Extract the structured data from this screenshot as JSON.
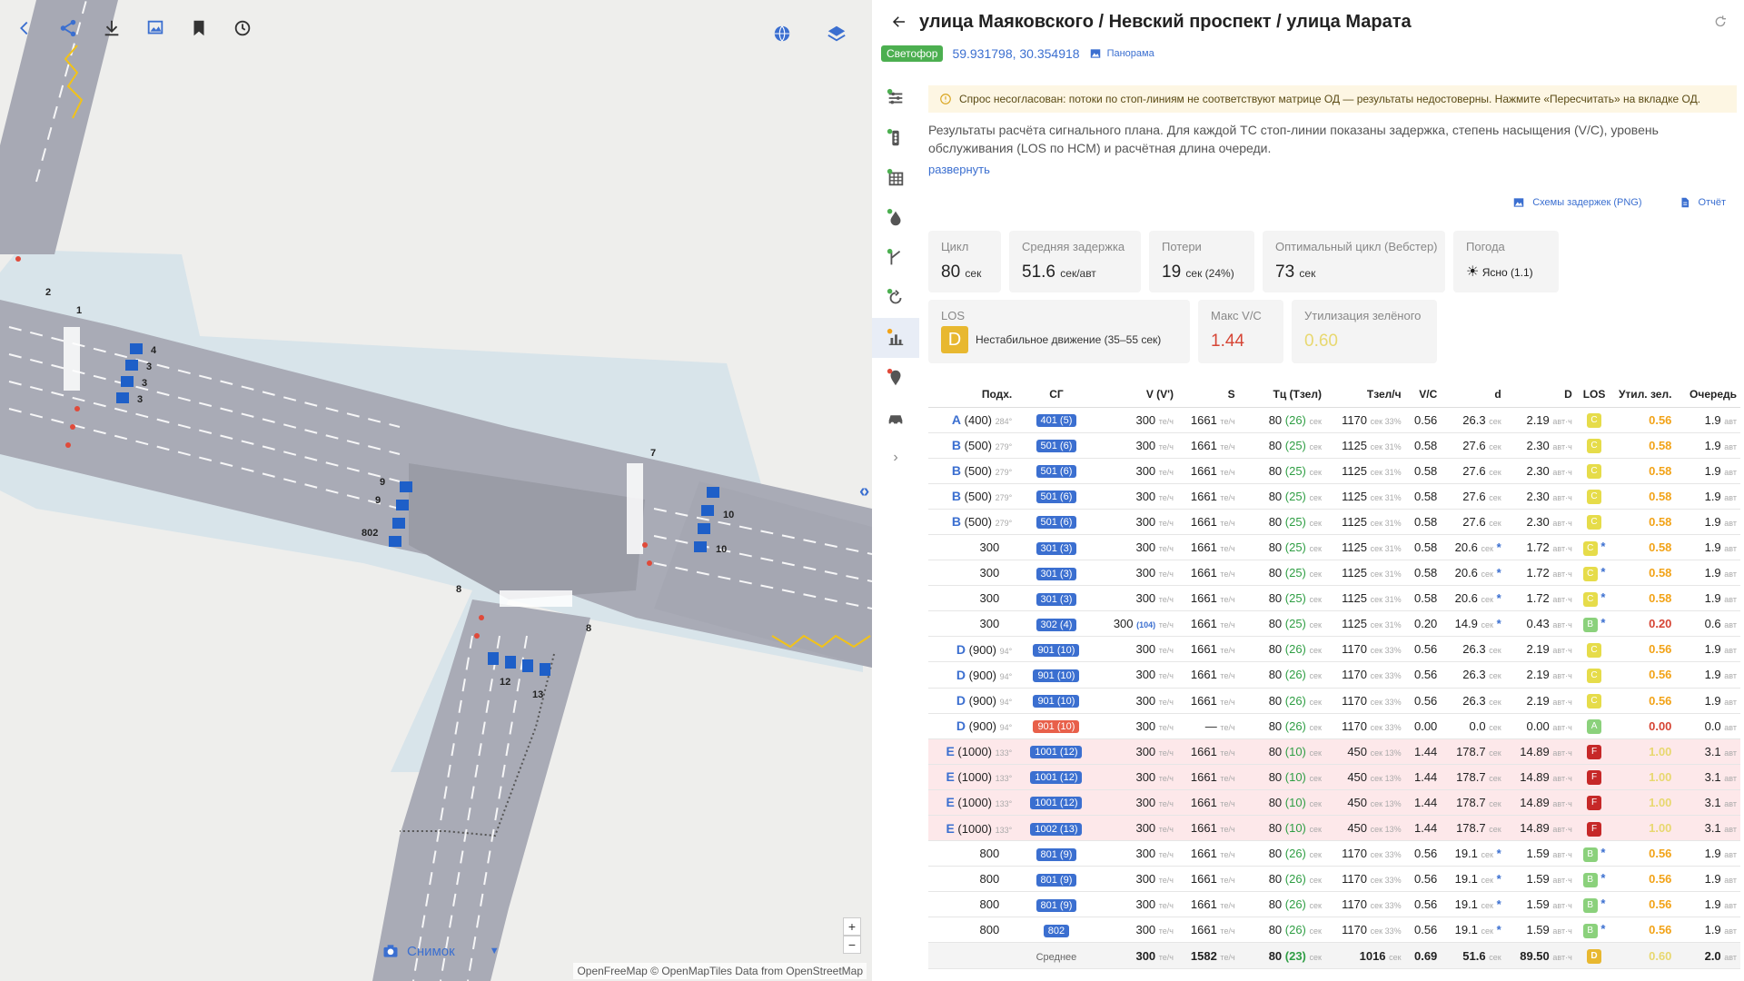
{
  "map": {
    "lane_numbers": [
      "4",
      "3",
      "3",
      "3",
      "9",
      "9",
      "802",
      "10",
      "10",
      "12",
      "13",
      "2",
      "1",
      "7",
      "8",
      "8"
    ],
    "snapshot_label": "Снимок",
    "attribution": "OpenFreeMap © OpenMapTiles Data from OpenStreetMap",
    "zoom_in": "+",
    "zoom_out": "−"
  },
  "header": {
    "title": "улица Маяковского / Невский проспект / улица Марата",
    "type_badge": "Светофор",
    "coords": "59.931798, 30.354918",
    "panorama": "Панорама"
  },
  "warning": "Спрос несогласован: потоки по стоп-линиям не соответствуют матрице ОД — результаты недостоверны. Нажмите «Пересчитать» на вкладке ОД.",
  "description": "Результаты расчёта сигнального плана. Для каждой ТС стоп-линии показаны задержка, степень насыщения (V/C), уровень обслуживания (LOS по HCM) и расчётная длина очереди.",
  "expand": "развернуть",
  "exports": {
    "png": "Схемы задержек (PNG)",
    "report": "Отчёт"
  },
  "stats": {
    "cycle": {
      "label": "Цикл",
      "value": "80",
      "unit": "сек"
    },
    "delay": {
      "label": "Средняя задержка",
      "value": "51.6",
      "unit": "сек/авт"
    },
    "losses": {
      "label": "Потери",
      "value": "19",
      "unit": "сек (24%)"
    },
    "opt_cycle": {
      "label": "Оптимальный цикл (Вебстер)",
      "value": "73",
      "unit": "сек"
    },
    "weather": {
      "label": "Погода",
      "value": "Ясно (1.1)"
    },
    "los": {
      "label": "LOS",
      "letter": "D",
      "text": "Нестабильное движение (35–55 сек)"
    },
    "max_vc": {
      "label": "Макс V/C",
      "value": "1.44",
      "color": "#d64535"
    },
    "green_util": {
      "label": "Утилизация зелёного",
      "value": "0.60",
      "color": "#e8d870"
    }
  },
  "table": {
    "headers": [
      "Подх.",
      "СГ",
      "V (V')",
      "S",
      "Тц (Тзел)",
      "Тзел/ч",
      "V/C",
      "d",
      "D",
      "LOS",
      "Утил. зел.",
      "Очередь"
    ],
    "units": {
      "veh_h": "те/ч",
      "sec": "сек",
      "veh_hour": "авт·ч",
      "veh": "авт"
    },
    "rows": [
      {
        "letter": "A",
        "app": "(400)",
        "deg": "284°",
        "sg": "401 (5)",
        "sg_red": false,
        "v": "300",
        "vp": "",
        "s": "1661",
        "tc": "80",
        "tg": "(26)",
        "tgh": "1170",
        "pct": "33%",
        "vc": "0.56",
        "d": "26.3",
        "dstar": false,
        "D": "2.19",
        "los": "C",
        "los_star": false,
        "util": "0.56",
        "q": "1.9",
        "red": false
      },
      {
        "letter": "B",
        "app": "(500)",
        "deg": "279°",
        "sg": "501 (6)",
        "sg_red": false,
        "v": "300",
        "vp": "",
        "s": "1661",
        "tc": "80",
        "tg": "(25)",
        "tgh": "1125",
        "pct": "31%",
        "vc": "0.58",
        "d": "27.6",
        "dstar": false,
        "D": "2.30",
        "los": "C",
        "los_star": false,
        "util": "0.58",
        "q": "1.9",
        "red": false
      },
      {
        "letter": "B",
        "app": "(500)",
        "deg": "279°",
        "sg": "501 (6)",
        "sg_red": false,
        "v": "300",
        "vp": "",
        "s": "1661",
        "tc": "80",
        "tg": "(25)",
        "tgh": "1125",
        "pct": "31%",
        "vc": "0.58",
        "d": "27.6",
        "dstar": false,
        "D": "2.30",
        "los": "C",
        "los_star": false,
        "util": "0.58",
        "q": "1.9",
        "red": false
      },
      {
        "letter": "B",
        "app": "(500)",
        "deg": "279°",
        "sg": "501 (6)",
        "sg_red": false,
        "v": "300",
        "vp": "",
        "s": "1661",
        "tc": "80",
        "tg": "(25)",
        "tgh": "1125",
        "pct": "31%",
        "vc": "0.58",
        "d": "27.6",
        "dstar": false,
        "D": "2.30",
        "los": "C",
        "los_star": false,
        "util": "0.58",
        "q": "1.9",
        "red": false
      },
      {
        "letter": "B",
        "app": "(500)",
        "deg": "279°",
        "sg": "501 (6)",
        "sg_red": false,
        "v": "300",
        "vp": "",
        "s": "1661",
        "tc": "80",
        "tg": "(25)",
        "tgh": "1125",
        "pct": "31%",
        "vc": "0.58",
        "d": "27.6",
        "dstar": false,
        "D": "2.30",
        "los": "C",
        "los_star": false,
        "util": "0.58",
        "q": "1.9",
        "red": false
      },
      {
        "letter": "",
        "app": "300",
        "deg": "",
        "sg": "301 (3)",
        "sg_red": false,
        "v": "300",
        "vp": "",
        "s": "1661",
        "tc": "80",
        "tg": "(25)",
        "tgh": "1125",
        "pct": "31%",
        "vc": "0.58",
        "d": "20.6",
        "dstar": true,
        "D": "1.72",
        "los": "C",
        "los_star": true,
        "util": "0.58",
        "q": "1.9",
        "red": false
      },
      {
        "letter": "",
        "app": "300",
        "deg": "",
        "sg": "301 (3)",
        "sg_red": false,
        "v": "300",
        "vp": "",
        "s": "1661",
        "tc": "80",
        "tg": "(25)",
        "tgh": "1125",
        "pct": "31%",
        "vc": "0.58",
        "d": "20.6",
        "dstar": true,
        "D": "1.72",
        "los": "C",
        "los_star": true,
        "util": "0.58",
        "q": "1.9",
        "red": false
      },
      {
        "letter": "",
        "app": "300",
        "deg": "",
        "sg": "301 (3)",
        "sg_red": false,
        "v": "300",
        "vp": "",
        "s": "1661",
        "tc": "80",
        "tg": "(25)",
        "tgh": "1125",
        "pct": "31%",
        "vc": "0.58",
        "d": "20.6",
        "dstar": true,
        "D": "1.72",
        "los": "C",
        "los_star": true,
        "util": "0.58",
        "q": "1.9",
        "red": false
      },
      {
        "letter": "",
        "app": "300",
        "deg": "",
        "sg": "302 (4)",
        "sg_red": false,
        "v": "300",
        "vp": "(104)",
        "s": "1661",
        "tc": "80",
        "tg": "(25)",
        "tgh": "1125",
        "pct": "31%",
        "vc": "0.20",
        "d": "14.9",
        "dstar": true,
        "D": "0.43",
        "los": "B",
        "los_star": true,
        "util": "0.20",
        "q": "0.6",
        "red": false
      },
      {
        "letter": "D",
        "app": "(900)",
        "deg": "94°",
        "sg": "901 (10)",
        "sg_red": false,
        "v": "300",
        "vp": "",
        "s": "1661",
        "tc": "80",
        "tg": "(26)",
        "tgh": "1170",
        "pct": "33%",
        "vc": "0.56",
        "d": "26.3",
        "dstar": false,
        "D": "2.19",
        "los": "C",
        "los_star": false,
        "util": "0.56",
        "q": "1.9",
        "red": false
      },
      {
        "letter": "D",
        "app": "(900)",
        "deg": "94°",
        "sg": "901 (10)",
        "sg_red": false,
        "v": "300",
        "vp": "",
        "s": "1661",
        "tc": "80",
        "tg": "(26)",
        "tgh": "1170",
        "pct": "33%",
        "vc": "0.56",
        "d": "26.3",
        "dstar": false,
        "D": "2.19",
        "los": "C",
        "los_star": false,
        "util": "0.56",
        "q": "1.9",
        "red": false
      },
      {
        "letter": "D",
        "app": "(900)",
        "deg": "94°",
        "sg": "901 (10)",
        "sg_red": false,
        "v": "300",
        "vp": "",
        "s": "1661",
        "tc": "80",
        "tg": "(26)",
        "tgh": "1170",
        "pct": "33%",
        "vc": "0.56",
        "d": "26.3",
        "dstar": false,
        "D": "2.19",
        "los": "C",
        "los_star": false,
        "util": "0.56",
        "q": "1.9",
        "red": false
      },
      {
        "letter": "D",
        "app": "(900)",
        "deg": "94°",
        "sg": "901 (10)",
        "sg_red": true,
        "v": "300",
        "vp": "",
        "s": "—",
        "tc": "80",
        "tg": "(26)",
        "tgh": "1170",
        "pct": "33%",
        "vc": "0.00",
        "d": "0.0",
        "dstar": false,
        "D": "0.00",
        "los": "A",
        "los_star": false,
        "util": "0.00",
        "q": "0.0",
        "red": false
      },
      {
        "letter": "E",
        "app": "(1000)",
        "deg": "133°",
        "sg": "1001 (12)",
        "sg_red": false,
        "v": "300",
        "vp": "",
        "s": "1661",
        "tc": "80",
        "tg": "(10)",
        "tgh": "450",
        "pct": "13%",
        "vc": "1.44",
        "d": "178.7",
        "dstar": false,
        "D": "14.89",
        "los": "F",
        "los_star": false,
        "util": "1.00",
        "q": "3.1",
        "red": true
      },
      {
        "letter": "E",
        "app": "(1000)",
        "deg": "133°",
        "sg": "1001 (12)",
        "sg_red": false,
        "v": "300",
        "vp": "",
        "s": "1661",
        "tc": "80",
        "tg": "(10)",
        "tgh": "450",
        "pct": "13%",
        "vc": "1.44",
        "d": "178.7",
        "dstar": false,
        "D": "14.89",
        "los": "F",
        "los_star": false,
        "util": "1.00",
        "q": "3.1",
        "red": true
      },
      {
        "letter": "E",
        "app": "(1000)",
        "deg": "133°",
        "sg": "1001 (12)",
        "sg_red": false,
        "v": "300",
        "vp": "",
        "s": "1661",
        "tc": "80",
        "tg": "(10)",
        "tgh": "450",
        "pct": "13%",
        "vc": "1.44",
        "d": "178.7",
        "dstar": false,
        "D": "14.89",
        "los": "F",
        "los_star": false,
        "util": "1.00",
        "q": "3.1",
        "red": true
      },
      {
        "letter": "E",
        "app": "(1000)",
        "deg": "133°",
        "sg": "1002 (13)",
        "sg_red": false,
        "v": "300",
        "vp": "",
        "s": "1661",
        "tc": "80",
        "tg": "(10)",
        "tgh": "450",
        "pct": "13%",
        "vc": "1.44",
        "d": "178.7",
        "dstar": false,
        "D": "14.89",
        "los": "F",
        "los_star": false,
        "util": "1.00",
        "q": "3.1",
        "red": true
      },
      {
        "letter": "",
        "app": "800",
        "deg": "",
        "sg": "801 (9)",
        "sg_red": false,
        "v": "300",
        "vp": "",
        "s": "1661",
        "tc": "80",
        "tg": "(26)",
        "tgh": "1170",
        "pct": "33%",
        "vc": "0.56",
        "d": "19.1",
        "dstar": true,
        "D": "1.59",
        "los": "B",
        "los_star": true,
        "util": "0.56",
        "q": "1.9",
        "red": false
      },
      {
        "letter": "",
        "app": "800",
        "deg": "",
        "sg": "801 (9)",
        "sg_red": false,
        "v": "300",
        "vp": "",
        "s": "1661",
        "tc": "80",
        "tg": "(26)",
        "tgh": "1170",
        "pct": "33%",
        "vc": "0.56",
        "d": "19.1",
        "dstar": true,
        "D": "1.59",
        "los": "B",
        "los_star": true,
        "util": "0.56",
        "q": "1.9",
        "red": false
      },
      {
        "letter": "",
        "app": "800",
        "deg": "",
        "sg": "801 (9)",
        "sg_red": false,
        "v": "300",
        "vp": "",
        "s": "1661",
        "tc": "80",
        "tg": "(26)",
        "tgh": "1170",
        "pct": "33%",
        "vc": "0.56",
        "d": "19.1",
        "dstar": true,
        "D": "1.59",
        "los": "B",
        "los_star": true,
        "util": "0.56",
        "q": "1.9",
        "red": false
      },
      {
        "letter": "",
        "app": "800",
        "deg": "",
        "sg": "802",
        "sg_red": false,
        "v": "300",
        "vp": "",
        "s": "1661",
        "tc": "80",
        "tg": "(26)",
        "tgh": "1170",
        "pct": "33%",
        "vc": "0.56",
        "d": "19.1",
        "dstar": true,
        "D": "1.59",
        "los": "B",
        "los_star": true,
        "util": "0.56",
        "q": "1.9",
        "red": false
      }
    ],
    "footer": {
      "label": "Среднее",
      "v": "300",
      "s": "1582",
      "tc": "80",
      "tg": "(23)",
      "tgh": "1016",
      "vc": "0.69",
      "d": "51.6",
      "D": "89.50",
      "los": "D",
      "util": "0.60",
      "q": "2.0"
    }
  },
  "colors": {
    "accent": "#3b6fd0",
    "los_A": "#8bd17c",
    "los_B": "#8bd17c",
    "los_C": "#e6dc4a",
    "los_D": "#e8b830",
    "los_F": "#c62828"
  }
}
